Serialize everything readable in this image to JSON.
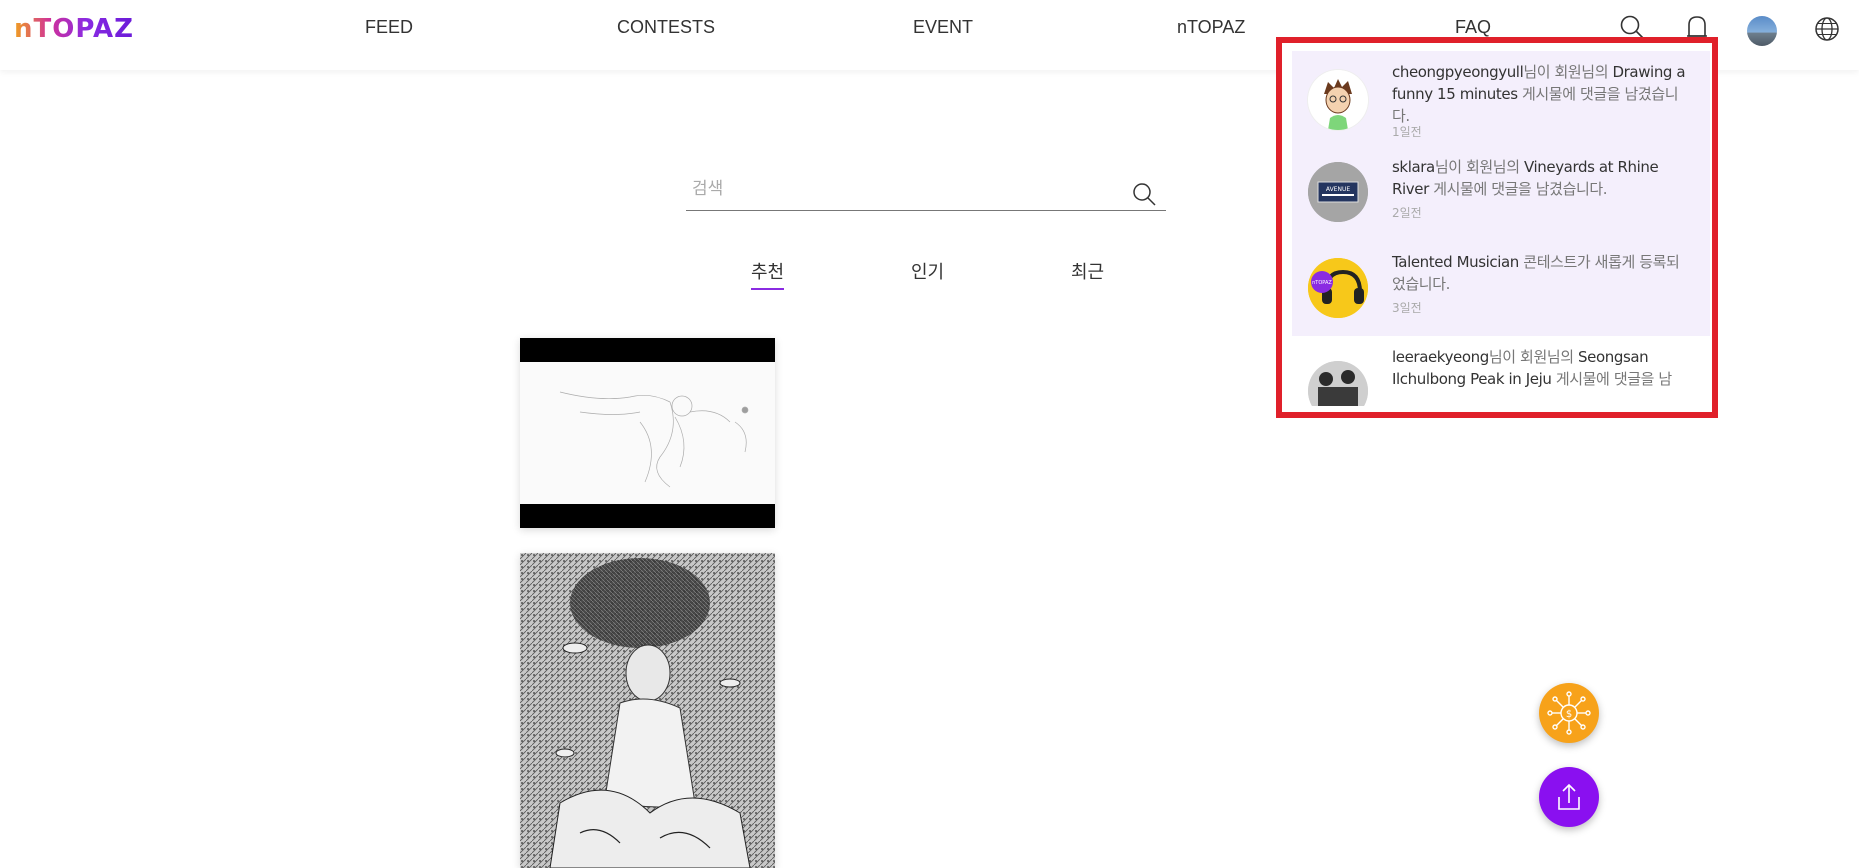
{
  "brand": {
    "logo_text": "nTOPAZ",
    "accent": "#8a2be2",
    "alert": "#e0202a"
  },
  "nav": {
    "items": [
      {
        "label": "FEED"
      },
      {
        "label": "CONTESTS"
      },
      {
        "label": "EVENT"
      },
      {
        "label": "nTOPAZ"
      },
      {
        "label": "FAQ"
      }
    ],
    "icons": [
      "search-icon",
      "bell-icon",
      "avatar",
      "globe-icon"
    ]
  },
  "search": {
    "placeholder": "검색",
    "value": ""
  },
  "tabs": [
    {
      "label": "추천",
      "active": true
    },
    {
      "label": "인기",
      "active": false
    },
    {
      "label": "최근",
      "active": false
    }
  ],
  "feed": {
    "cards": [
      "artwork-sketch-mermaid",
      "artwork-pen-drawing-girl"
    ]
  },
  "notifications": [
    {
      "user": "cheongpyeongyull",
      "middle": "님이 회원님의 ",
      "subject": "Drawing a funny 15 minutes",
      "tail": " 게시물에 댓글을 남겼습니다.",
      "time": "1일전",
      "read": false
    },
    {
      "user": "sklara",
      "middle": "님이 회원님의 ",
      "subject": "Vineyards at Rhine River",
      "tail": " 게시물에 댓글을 남겼습니다.",
      "time": "2일전",
      "read": false
    },
    {
      "user": "Talented Musician",
      "middle": " ",
      "subject": "",
      "tail": "콘테스트가 새롭게 등록되었습니다.",
      "time": "3일전",
      "read": false
    },
    {
      "user": "leeraekyeong",
      "middle": "님이 회원님의 ",
      "subject": "Seongsan Ilchulbong Peak in Jeju",
      "tail": " 게시물에 댓글을 남",
      "time": "",
      "read": true
    }
  ],
  "avatars": {
    "avenue_sign_text": "AVENUE",
    "contest_badge_text": "nTOPAZ"
  },
  "fab": {
    "orange_color": "#f7a21a",
    "purple_color": "#8a10f0"
  }
}
